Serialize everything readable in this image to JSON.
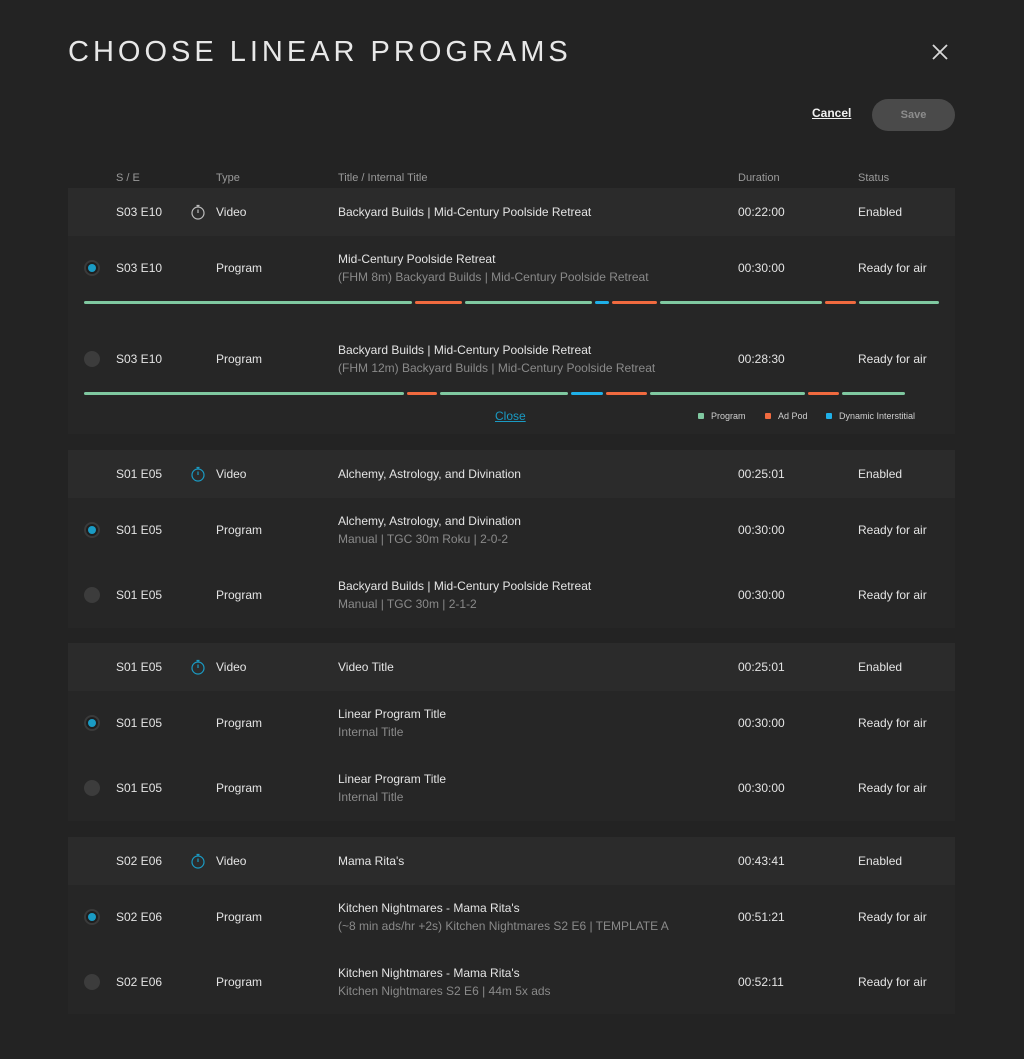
{
  "header": {
    "title": "CHOOSE LINEAR PROGRAMS",
    "cancel_label": "Cancel",
    "save_label": "Save"
  },
  "columns": {
    "se": "S / E",
    "type": "Type",
    "title": "Title / Internal Title",
    "duration": "Duration",
    "status": "Status"
  },
  "colors": {
    "program": "#7fc8a0",
    "ad_pod": "#f06a3f",
    "dynamic_interstitial": "#1fb0e8",
    "accent": "#1a9bc4"
  },
  "expanded": {
    "close_label": "Close",
    "legend": [
      "Program",
      "Ad Pod",
      "Dynamic Interstitial"
    ]
  },
  "groups": [
    {
      "video": {
        "se": "S03 E10",
        "type": "Video",
        "title": "Backyard Builds | Mid-Century Poolside Retreat",
        "duration": "00:22:00",
        "status": "Enabled"
      },
      "programs": [
        {
          "selected": true,
          "se": "S03 E10",
          "type": "Program",
          "title": "Mid-Century Poolside Retreat",
          "internal": "(FHM 8m) Backyard Builds | Mid-Century Poolside Retreat",
          "duration": "00:30:00",
          "status": "Ready for air"
        },
        {
          "selected": false,
          "se": "S03 E10",
          "type": "Program",
          "title": "Backyard Builds | Mid-Century Poolside Retreat",
          "internal": "(FHM 12m) Backyard Builds | Mid-Century Poolside Retreat",
          "duration": "00:28:30",
          "status": "Ready for air"
        }
      ]
    },
    {
      "video": {
        "se": "S01 E05",
        "type": "Video",
        "title": "Alchemy, Astrology, and Divination",
        "duration": "00:25:01",
        "status": "Enabled"
      },
      "programs": [
        {
          "selected": true,
          "se": "S01 E05",
          "type": "Program",
          "title": "Alchemy, Astrology, and Divination",
          "internal": "Manual | TGC 30m Roku | 2-0-2",
          "duration": "00:30:00",
          "status": "Ready for air"
        },
        {
          "selected": false,
          "se": "S01 E05",
          "type": "Program",
          "title": "Backyard Builds | Mid-Century Poolside Retreat",
          "internal": "Manual | TGC 30m | 2-1-2",
          "duration": "00:30:00",
          "status": "Ready for air"
        }
      ]
    },
    {
      "video": {
        "se": "S01 E05",
        "type": "Video",
        "title": "Video Title",
        "duration": "00:25:01",
        "status": "Enabled"
      },
      "programs": [
        {
          "selected": true,
          "se": "S01 E05",
          "type": "Program",
          "title": "Linear Program Title",
          "internal": "Internal Title",
          "duration": "00:30:00",
          "status": "Ready for air"
        },
        {
          "selected": false,
          "se": "S01 E05",
          "type": "Program",
          "title": "Linear Program Title",
          "internal": "Internal Title",
          "duration": "00:30:00",
          "status": "Ready for air"
        }
      ]
    },
    {
      "video": {
        "se": "S02 E06",
        "type": "Video",
        "title": "Mama Rita's",
        "duration": "00:43:41",
        "status": "Enabled"
      },
      "programs": [
        {
          "selected": true,
          "se": "S02 E06",
          "type": "Program",
          "title": "Kitchen Nightmares - Mama Rita's",
          "internal": "(~8 min ads/hr +2s) Kitchen Nightmares S2 E6 | TEMPLATE A",
          "duration": "00:51:21",
          "status": "Ready for air"
        },
        {
          "selected": false,
          "se": "S02 E06",
          "type": "Program",
          "title": "Kitchen Nightmares - Mama Rita's",
          "internal": "Kitchen Nightmares S2 E6 | 44m 5x ads",
          "duration": "00:52:11",
          "status": "Ready for air"
        }
      ]
    }
  ]
}
